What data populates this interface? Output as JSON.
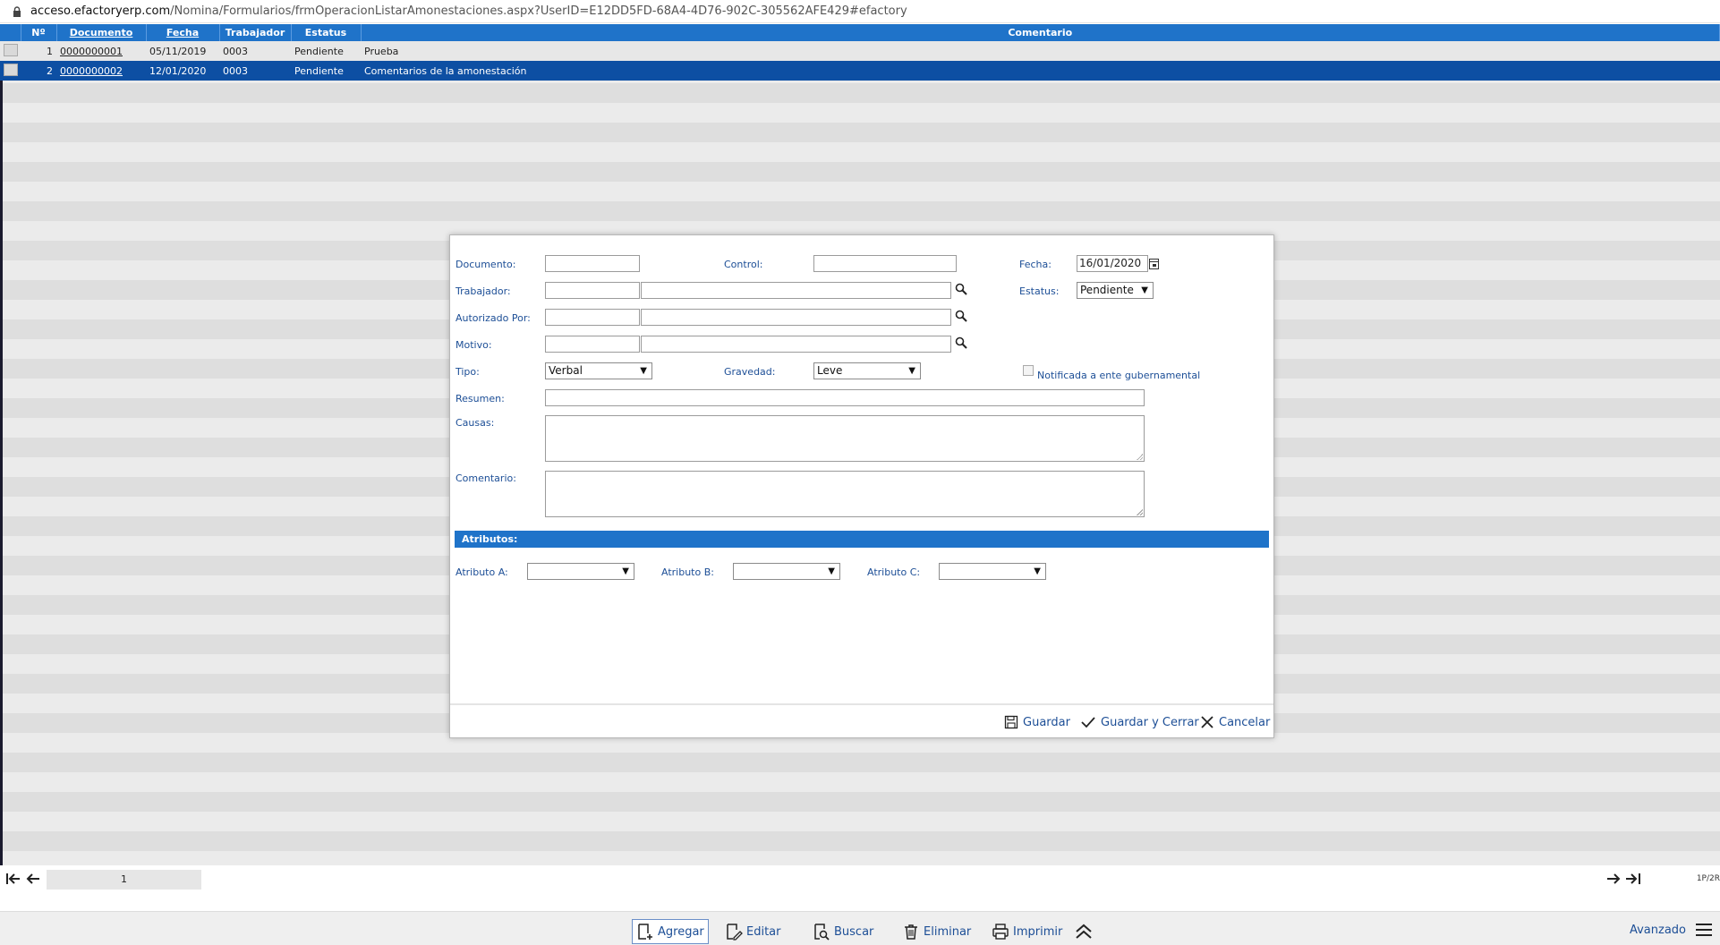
{
  "url": {
    "host": "acceso.efactoryerp.com",
    "path": "/Nomina/Formularios/frmOperacionListarAmonestaciones.aspx?UserID=E12DD5FD-68A4-4D76-902C-305562AFE429#efactory"
  },
  "table": {
    "headers": [
      "Nº",
      "Documento",
      "Fecha",
      "Trabajador",
      "Estatus",
      "Comentario"
    ],
    "rows": [
      {
        "n": "1",
        "documento": "0000000001",
        "fecha": "05/11/2019",
        "trabajador": "0003",
        "estatus": "Pendiente",
        "comentario": "Prueba",
        "selected": false
      },
      {
        "n": "2",
        "documento": "0000000002",
        "fecha": "12/01/2020",
        "trabajador": "0003",
        "estatus": "Pendiente",
        "comentario": "Comentarios de la amonestación",
        "selected": true
      }
    ]
  },
  "pager": {
    "page": "1",
    "info": "1P/2R"
  },
  "form": {
    "documento_label": "Documento:",
    "control_label": "Control:",
    "fecha_label": "Fecha:",
    "fecha_value": "16/01/2020",
    "trabajador_label": "Trabajador:",
    "estatus_label": "Estatus:",
    "estatus_value": "Pendiente",
    "autorizado_label": "Autorizado Por:",
    "motivo_label": "Motivo:",
    "tipo_label": "Tipo:",
    "tipo_value": "Verbal",
    "gravedad_label": "Gravedad:",
    "gravedad_value": "Leve",
    "notificada_label": "Notificada a ente gubernamental",
    "resumen_label": "Resumen:",
    "causas_label": "Causas:",
    "comentario_label": "Comentario:",
    "atributos_title": "Atributos:",
    "atributo_a_label": "Atributo A:",
    "atributo_b_label": "Atributo B:",
    "atributo_c_label": "Atributo C:",
    "guardar": "Guardar",
    "guardar_cerrar": "Guardar y Cerrar",
    "cancelar": "Cancelar"
  },
  "toolbar": {
    "agregar": "Agregar",
    "editar": "Editar",
    "buscar": "Buscar",
    "eliminar": "Eliminar",
    "imprimir": "Imprimir",
    "avanzado": "Avanzado"
  },
  "colors": {
    "header_blue": "#1f73c9",
    "selected_row": "#0d4fa3",
    "link_blue": "#1c4e96"
  }
}
